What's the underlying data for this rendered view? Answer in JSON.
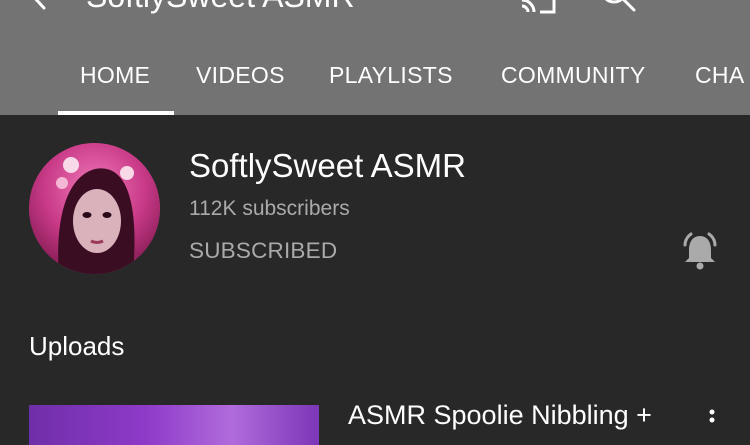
{
  "appbar": {
    "channel_title": "SoftlySweet ASMR"
  },
  "tabs": [
    {
      "label": "HOME",
      "active": true
    },
    {
      "label": "VIDEOS",
      "active": false
    },
    {
      "label": "PLAYLISTS",
      "active": false
    },
    {
      "label": "COMMUNITY",
      "active": false
    },
    {
      "label": "CHA",
      "active": false
    }
  ],
  "channel": {
    "name": "SoftlySweet ASMR",
    "subscribers": "112K subscribers",
    "subscribe_state": "SUBSCRIBED"
  },
  "uploads": {
    "section_title": "Uploads",
    "first_video_title": "ASMR Spoolie Nibbling +"
  },
  "colors": {
    "app_bar": "#737373",
    "background": "#282828",
    "primary_text": "#ffffff",
    "secondary_text": "#aaaaaa"
  },
  "icons": {
    "back": "back-arrow-icon",
    "cast": "cast-icon",
    "search": "search-icon",
    "more": "more-vert-icon",
    "bell": "bell-icon"
  }
}
